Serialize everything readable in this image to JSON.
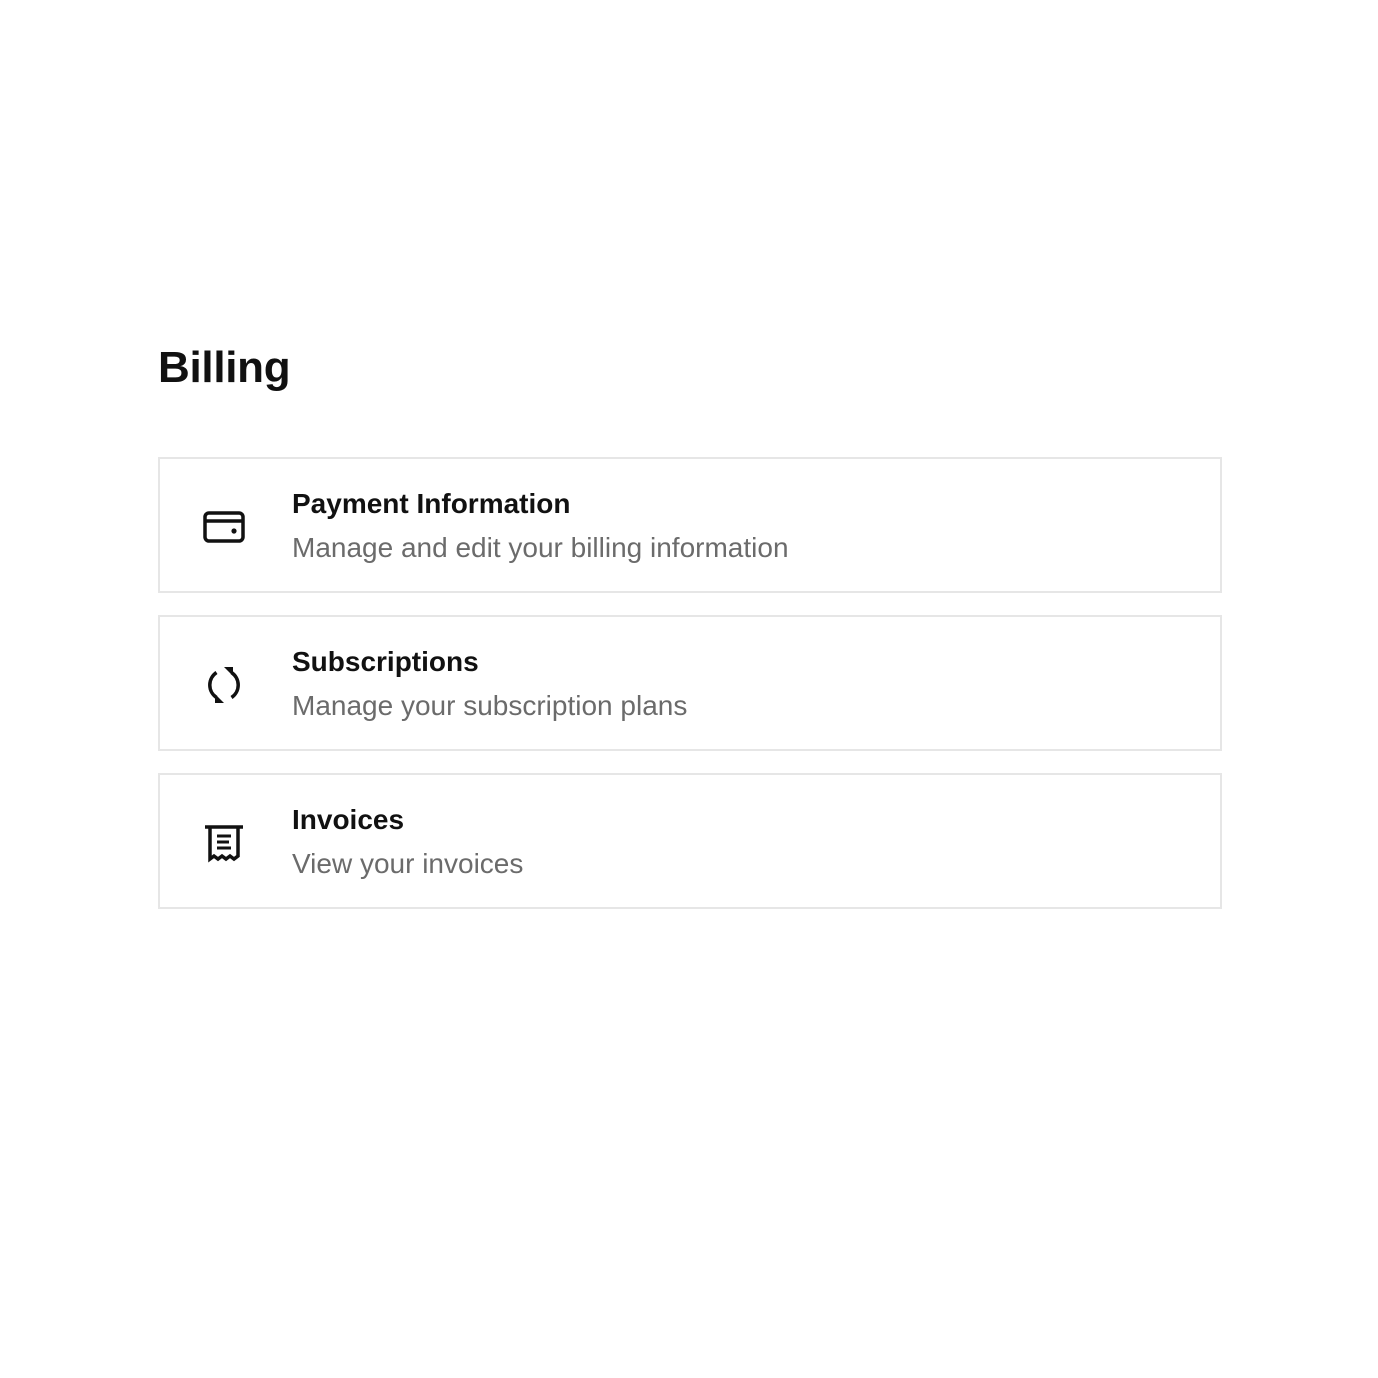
{
  "page": {
    "title": "Billing"
  },
  "cards": [
    {
      "icon": "credit-card-icon",
      "title": "Payment Information",
      "description": "Manage and edit your billing information"
    },
    {
      "icon": "sync-icon",
      "title": "Subscriptions",
      "description": "Manage your subscription plans"
    },
    {
      "icon": "receipt-icon",
      "title": "Invoices",
      "description": "View your invoices"
    }
  ],
  "colors": {
    "text_primary": "#111111",
    "text_secondary": "#6b6b6b",
    "card_border": "#e6e6e6",
    "background": "#ffffff"
  }
}
